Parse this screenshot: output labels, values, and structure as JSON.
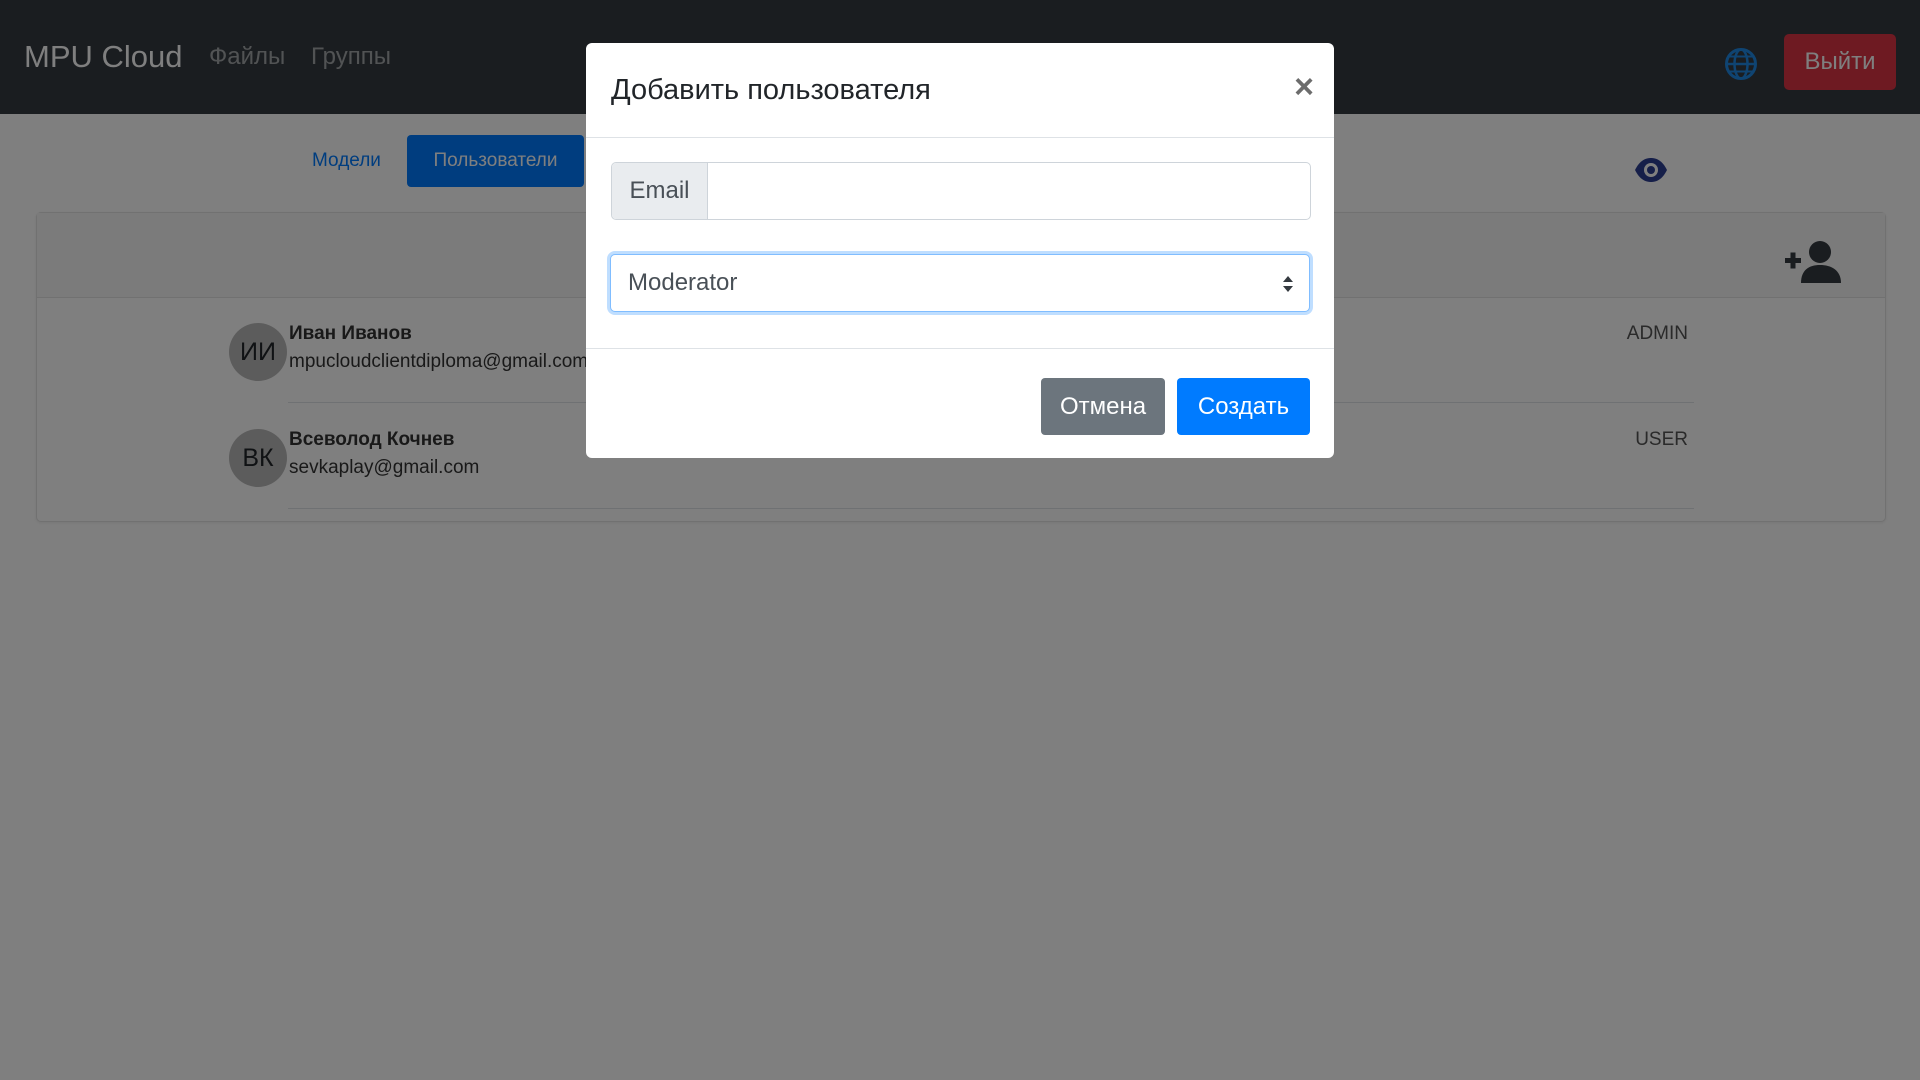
{
  "navbar": {
    "brand": "MPU Cloud",
    "links": [
      "Файлы",
      "Группы"
    ],
    "globe_icon": "globe-icon",
    "logout_label": "Выйти"
  },
  "tabs": {
    "models": "Модели",
    "users": "Пользователи"
  },
  "toolbar": {
    "eye_icon": "eye-icon",
    "add_user_icon": "user-plus-icon"
  },
  "users": [
    {
      "initials": "ИИ",
      "name": "Иван Иванов",
      "email": "mpucloudclientdiploma@gmail.com",
      "role": "ADMIN"
    },
    {
      "initials": "ВК",
      "name": "Всеволод Кочнев",
      "email": "sevkaplay@gmail.com",
      "role": "USER"
    }
  ],
  "modal": {
    "title": "Добавить пользователя",
    "close_symbol": "×",
    "email_label": "Email",
    "email_value": "",
    "role_selected": "Moderator",
    "cancel_label": "Отмена",
    "create_label": "Создать"
  },
  "colors": {
    "navbar": "#343a40",
    "primary": "#007bff",
    "danger": "#dc3545",
    "secondary": "#6c757d"
  }
}
